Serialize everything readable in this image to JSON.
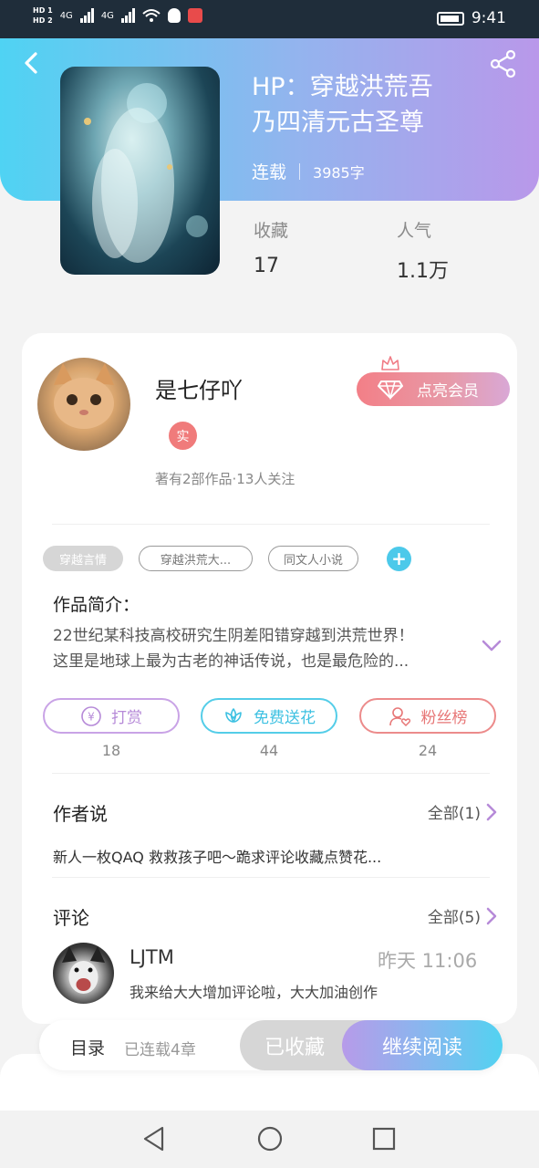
{
  "status_bar": {
    "hd1": "HD 1",
    "hd2": "HD 2",
    "net1": "4G",
    "net2": "4G",
    "time": "9:41"
  },
  "book": {
    "title_line1": "HP：穿越洪荒吾",
    "title_line2": "乃四清元古圣尊",
    "status": "连载",
    "word_count": "3985字",
    "favorites_label": "收藏",
    "favorites_value": "17",
    "popularity_label": "人气",
    "popularity_value": "1.1万"
  },
  "author": {
    "name": "是七仔吖",
    "real_badge": "实",
    "desc": "著有2部作品·13人关注",
    "vip_button": "点亮会员"
  },
  "tags": {
    "items": [
      "穿越言情",
      "穿越洪荒大...",
      "同文人小说"
    ],
    "add": "+"
  },
  "intro": {
    "title": "作品简介：",
    "line1": "22世纪某科技高校研究生阴差阳错穿越到洪荒世界！",
    "line2": "这里是地球上最为古老的神话传说，也是最危险的..."
  },
  "actions": {
    "tip": {
      "label": "打赏",
      "count": "18"
    },
    "flower": {
      "label": "免费送花",
      "count": "44"
    },
    "fans": {
      "label": "粉丝榜",
      "count": "24"
    },
    "yen_glyph": "¥"
  },
  "author_says": {
    "title": "作者说",
    "all": "全部(1)",
    "text": "新人一枚QAQ 救救孩子吧～跪求评论收藏点赞花..."
  },
  "comments": {
    "title": "评论",
    "all": "全部(5)",
    "items": [
      {
        "name": "LJTM",
        "time": "昨天 11:06",
        "text": "我来给大大增加评论啦，大大加油创作"
      }
    ]
  },
  "bottom": {
    "toc": "目录",
    "toc_sub": "已连载4章",
    "saved": "已收藏",
    "read": "继续阅读"
  },
  "colors": {
    "header_start": "#4fd3f3",
    "header_end": "#b998ea",
    "tip": "#b68ad8",
    "flower": "#3ec1e2",
    "fans": "#e77676",
    "vip": "#f37f87"
  },
  "icons": [
    "back-icon",
    "share-icon",
    "crown-icon",
    "diamond-icon",
    "add-icon",
    "expand-icon",
    "yen-icon",
    "flower-icon",
    "fans-icon",
    "chevron-right-icon",
    "nav-back-icon",
    "nav-home-icon",
    "nav-recent-icon"
  ]
}
